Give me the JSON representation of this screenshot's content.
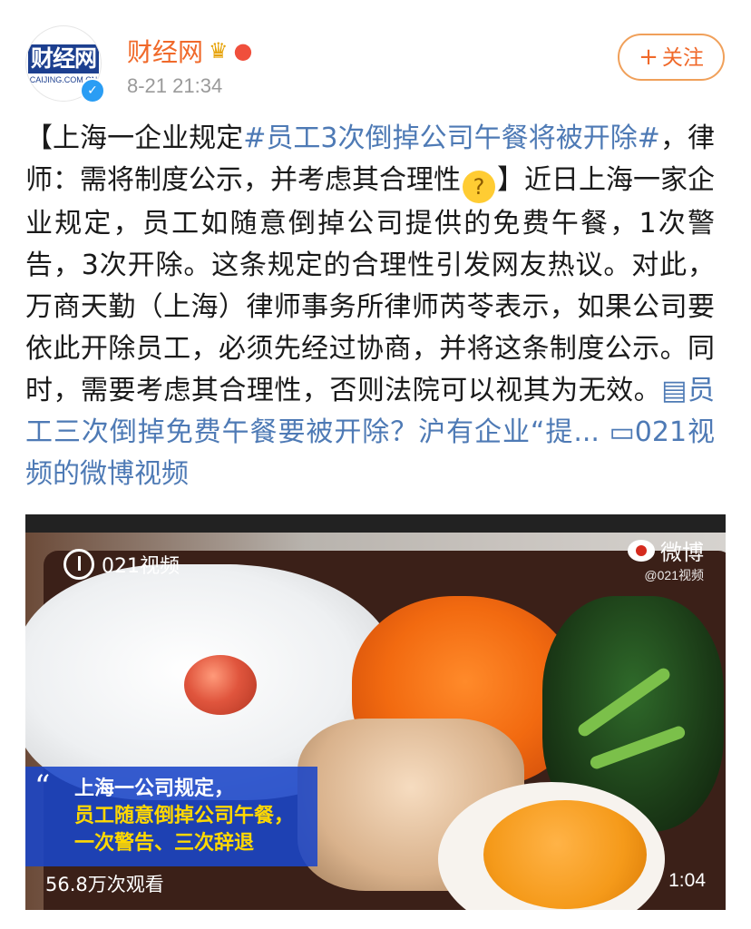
{
  "header": {
    "avatar_text_top": "财经网",
    "avatar_text_bottom": "CAIJING.COM.CN",
    "username": "财经网",
    "timestamp": "8-21 21:34",
    "follow_label": "关注",
    "follow_plus": "+"
  },
  "post": {
    "p1": "【上海一企业规定",
    "hashtag": "#员工3次倒掉公司午餐将被开除#",
    "p2": "，律师：需将制度公示，并考虑其合理性",
    "p3": "】近日上海一家企业规定，员工如随意倒掉公司提供的免费午餐，1次警告，3次开除。这条规定的合理性引发网友热议。对此，万商天勤（上海）律师事务所律师芮苓表示，如果公司要依此开除员工，必须先经过协商，并将这条制度公示。同时，需要考虑其合理性，否则法院可以视其为无效。",
    "article_link": "员工三次倒掉免费午餐要被开除？沪有企业“提...",
    "video_link": "021视频的微博视频"
  },
  "video": {
    "channel_logo": "021视频",
    "watermark_main": "微博",
    "watermark_sub": "@021视频",
    "caption_line1": "上海一公司规定，",
    "caption_line2": "员工随意倒掉公司午餐，",
    "caption_line3": "一次警告、三次辞退",
    "views": "56.8万次观看",
    "duration": "1:04"
  },
  "colors": {
    "username": "#f0692a",
    "link": "#4e7ab5",
    "caption_bg": "#1a46c8",
    "caption_highlight": "#ffd800"
  }
}
